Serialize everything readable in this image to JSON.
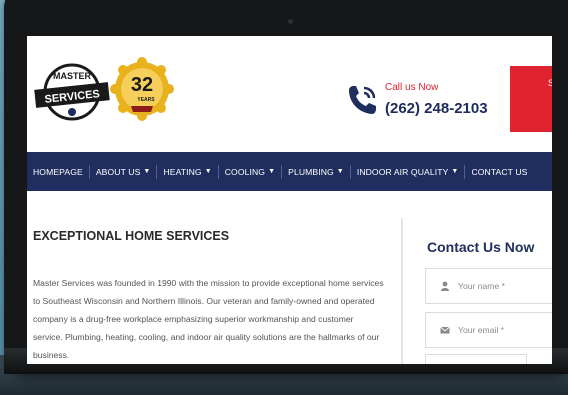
{
  "header": {
    "logo_text_top": "MASTER",
    "logo_text_bottom": "SERVICES",
    "badge_number": "32",
    "badge_label": "YEARS",
    "call_label": "Call us Now",
    "call_number": "(262) 248-2103",
    "cta_label": "S"
  },
  "nav": {
    "items": [
      {
        "label": "HOMEPAGE",
        "caret": ""
      },
      {
        "label": "ABOUT US",
        "caret": "▼"
      },
      {
        "label": "HEATING",
        "caret": "▼"
      },
      {
        "label": "COOLING",
        "caret": "▼"
      },
      {
        "label": "PLUMBING",
        "caret": "▼"
      },
      {
        "label": "INDOOR AIR QUALITY",
        "caret": "▼"
      },
      {
        "label": "CONTACT US",
        "caret": ""
      }
    ]
  },
  "main": {
    "title": "EXCEPTIONAL HOME SERVICES",
    "body": "Master Services was founded in 1990 with the mission to provide exceptional home services to Southeast Wisconsin and Northern Illinois. Our veteran and family-owned and operated company is a drug-free workplace emphasizing superior workmanship and customer service. Plumbing, heating, cooling, and indoor air quality solutions are the hallmarks of our business."
  },
  "form": {
    "title": "Contact Us Now",
    "name_placeholder": "Your name *",
    "email_placeholder": "Your email *"
  },
  "colors": {
    "navy": "#1f2e5e",
    "red": "#e0242f",
    "gold": "#e8b21d"
  }
}
